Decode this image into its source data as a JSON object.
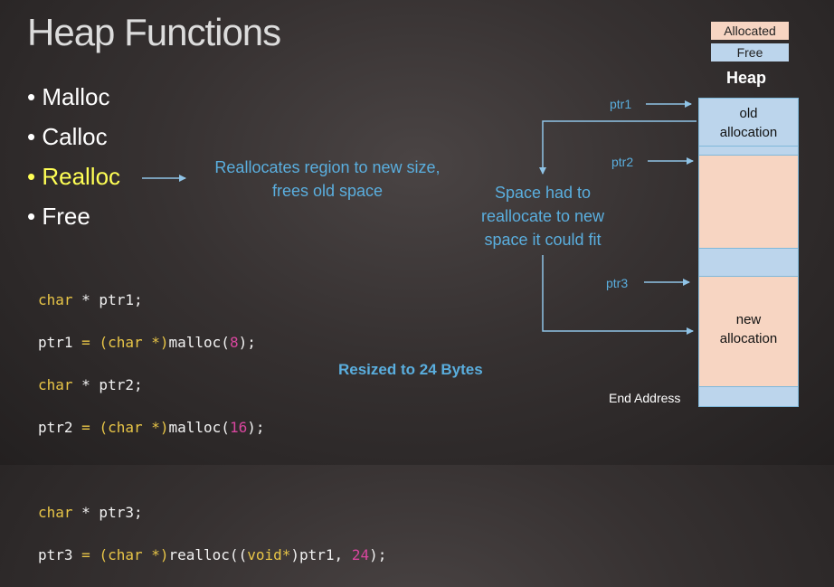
{
  "title": "Heap Functions",
  "bullets": [
    {
      "text": "• Malloc",
      "highlighted": false
    },
    {
      "text": "• Calloc",
      "highlighted": false
    },
    {
      "text": "• Realloc",
      "highlighted": true
    },
    {
      "text": "• Free",
      "highlighted": false
    }
  ],
  "realloc_description": {
    "line1": "Reallocates region to new size,",
    "line2": "frees old space"
  },
  "space_note": {
    "line1": "Space had to",
    "line2": "reallocate to new",
    "line3": "space it could fit"
  },
  "code": {
    "line1": {
      "type": "char",
      "rest": " * ptr1;"
    },
    "line2": {
      "lhs": "ptr1",
      "eq": " = ",
      "cast": "(char *)",
      "fn": "malloc(",
      "arg": "8",
      "end": ");"
    },
    "line3": {
      "type": "char",
      "rest": " * ptr2;"
    },
    "line4": {
      "lhs": "ptr2",
      "eq": " = ",
      "cast": "(char *)",
      "fn": "malloc(",
      "arg": "16",
      "end": ");"
    },
    "line5": {
      "type": "char",
      "rest": " * ptr3;"
    },
    "line6": {
      "lhs": "ptr3",
      "eq": " = ",
      "cast": "(char *)",
      "fn": "realloc((",
      "cast2": "void*",
      "mid": ")ptr1, ",
      "arg": "24",
      "end": ");"
    }
  },
  "resized_note": "Resized to 24 Bytes",
  "legend": {
    "allocated": "Allocated",
    "free": "Free"
  },
  "heap": {
    "label": "Heap",
    "old_allocation": {
      "line1": "old",
      "line2": "allocation"
    },
    "new_allocation": {
      "line1": "new",
      "line2": "allocation"
    },
    "end_address": "End Address"
  },
  "pointers": {
    "ptr1": "ptr1",
    "ptr2": "ptr2",
    "ptr3": "ptr3"
  },
  "colors": {
    "blue": "#5aaede",
    "allocated": "#f7d5c2",
    "free": "#bcd5ec",
    "highlight": "#ffff55"
  }
}
